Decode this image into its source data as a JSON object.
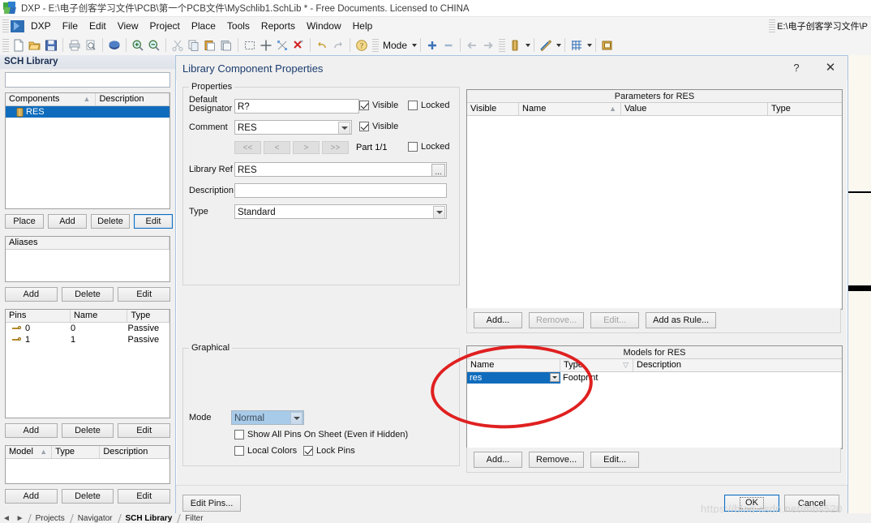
{
  "window": {
    "title": "DXP - E:\\电子创客学习文件\\PCB\\第一个PCB文件\\MySchlib1.SchLib * - Free Documents. Licensed to CHINA",
    "icon": "altium-dxp-icon"
  },
  "menubar": {
    "logo_label": "DXP",
    "items": [
      "File",
      "Edit",
      "View",
      "Project",
      "Place",
      "Tools",
      "Reports",
      "Window",
      "Help"
    ],
    "path_value": "E:\\电子创客学习文件\\P"
  },
  "toolbar": {
    "icons": [
      "new-document-icon",
      "open-folder-icon",
      "save-icon",
      "print-icon",
      "print-preview-icon",
      "board-icon",
      "zoom-in-icon",
      "zoom-out-icon",
      "cut-icon",
      "copy-icon",
      "paste-icon",
      "paste-special-icon",
      "select-area-icon",
      "move-icon",
      "deselect-icon",
      "clear-filter-icon",
      "undo-icon",
      "redo-icon",
      "help-icon",
      "plus-icon",
      "minus-icon",
      "back-icon",
      "forward-icon",
      "component-icon",
      "draw-tools-icon",
      "grid-icon",
      "place-part-icon"
    ],
    "mode_label": "Mode"
  },
  "sidebar": {
    "title": "SCH Library",
    "search_value": "",
    "components": {
      "columns": [
        "Components",
        "Description"
      ],
      "sort_marker": "▲",
      "rows": [
        {
          "icon": "component-icon",
          "name": "RES",
          "description": "",
          "selected": true
        }
      ]
    },
    "components_buttons": [
      "Place",
      "Add",
      "Delete",
      "Edit"
    ],
    "aliases": {
      "columns": [
        "Aliases"
      ],
      "rows": []
    },
    "aliases_buttons": [
      "Add",
      "Delete",
      "Edit"
    ],
    "pins": {
      "columns": [
        "Pins",
        "Name",
        "Type"
      ],
      "rows": [
        {
          "icon": "pin-icon",
          "pin": "0",
          "name": "0",
          "type": "Passive"
        },
        {
          "icon": "pin-icon",
          "pin": "1",
          "name": "1",
          "type": "Passive"
        }
      ]
    },
    "pins_buttons": [
      "Add",
      "Delete",
      "Edit"
    ],
    "model": {
      "columns": [
        "Model",
        "Type",
        "Description"
      ],
      "sort_marker": "▲",
      "rows": []
    },
    "model_buttons": [
      "Add",
      "Delete",
      "Edit"
    ]
  },
  "bottom_tabs": {
    "arrows": "◄ ►",
    "items": [
      {
        "label": "Projects",
        "active": false
      },
      {
        "label": "Navigator",
        "active": false
      },
      {
        "label": "SCH Library",
        "active": true
      },
      {
        "label": "Filter",
        "active": false
      }
    ]
  },
  "dialog": {
    "title": "Library Component Properties",
    "help_button": "?",
    "close_button": "✕",
    "properties": {
      "legend": "Properties",
      "default_designator_label": "Default Designator",
      "default_designator_value": "R?",
      "default_designator_visible_label": "Visible",
      "default_designator_visible_checked": true,
      "default_designator_locked_label": "Locked",
      "default_designator_locked_checked": false,
      "comment_label": "Comment",
      "comment_value": "RES",
      "comment_visible_label": "Visible",
      "comment_visible_checked": true,
      "nav_buttons": [
        "<<",
        "<",
        ">",
        ">>"
      ],
      "part_text": "Part 1/1",
      "part_locked_label": "Locked",
      "part_locked_checked": false,
      "library_ref_label": "Library Ref",
      "library_ref_value": "RES",
      "library_ref_browse": "...",
      "description_label": "Description",
      "description_value": "",
      "type_label": "Type",
      "type_value": "Standard"
    },
    "graphical": {
      "legend": "Graphical",
      "mode_label": "Mode",
      "mode_value": "Normal",
      "show_all_pins_label": "Show All Pins On Sheet (Even if Hidden)",
      "show_all_pins_checked": false,
      "local_colors_label": "Local Colors",
      "local_colors_checked": false,
      "lock_pins_label": "Lock Pins",
      "lock_pins_checked": true
    },
    "parameters": {
      "caption": "Parameters for RES",
      "columns": [
        "Visible",
        "Name",
        "Value",
        "Type"
      ],
      "sort_marker": "▲",
      "rows": [],
      "buttons": [
        {
          "label": "Add...",
          "disabled": false
        },
        {
          "label": "Remove...",
          "disabled": true
        },
        {
          "label": "Edit...",
          "disabled": true
        },
        {
          "label": "Add as Rule...",
          "disabled": false
        }
      ]
    },
    "models": {
      "caption": "Models for RES",
      "columns": [
        "Name",
        "Type",
        "Description"
      ],
      "sort_marker": "▽",
      "rows": [
        {
          "name": "res",
          "type": "Footprint",
          "description": "",
          "editing": true
        }
      ],
      "buttons": [
        {
          "label": "Add...",
          "disabled": false
        },
        {
          "label": "Remove...",
          "disabled": false
        },
        {
          "label": "Edit...",
          "disabled": false
        }
      ]
    },
    "footer": {
      "edit_pins_label": "Edit Pins...",
      "ok_label": "OK",
      "cancel_label": "Cancel"
    }
  },
  "annotation": {
    "shape": "red-ellipse-highlight"
  },
  "watermark": "https://blog.csdn.net/mbs520",
  "colors": {
    "selection_blue": "#0f6cbd",
    "annotation_red": "#e02020",
    "dialog_title_blue": "#1a3c6e"
  }
}
